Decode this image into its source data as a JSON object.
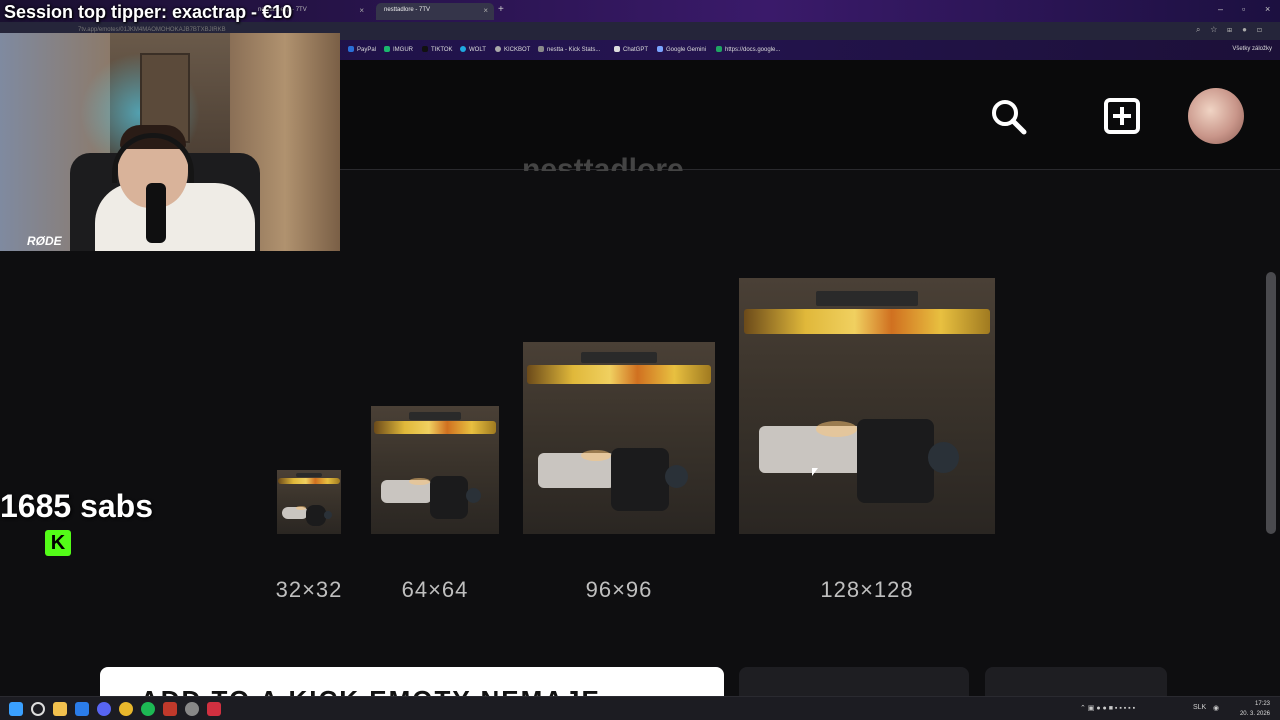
{
  "browser": {
    "tabs": [
      {
        "label": "nesttaseexp - 7TV",
        "active": false
      },
      {
        "label": "nesttadlore - 7TV",
        "active": true
      }
    ],
    "url": "7tv.app/emotes/01JKM4MAOMOHOKAJB7BTXBJIRKB",
    "bookmarks": [
      "PayPal",
      "IMGUR",
      "TIKTOK",
      "WOLT",
      "KICKBOT",
      "nestta - Kick Stats...",
      "ChatGPT",
      "Google Gemini",
      "https://docs.google..."
    ],
    "bookmarks_right": "Všetky záložky"
  },
  "overlay": {
    "title": "Session top tipper: exactrap - €10",
    "subs_count": "1685 sabs",
    "kick_logo": "K",
    "cam_brand": "RØDE"
  },
  "site": {
    "cut_title": "nesttadlore",
    "header_icons": [
      "search-icon",
      "add-icon",
      "avatar"
    ]
  },
  "emote_sizes": [
    {
      "label": "32×32"
    },
    {
      "label": "64×64"
    },
    {
      "label": "96×96"
    },
    {
      "label": "128×128"
    }
  ],
  "bottom": {
    "main_button": "ADD TO A KICK EMOTY NEMAJE"
  },
  "taskbar": {
    "lang": "SLK",
    "time": "17:23",
    "date": "20. 3. 2026"
  },
  "colors": {
    "kick_green": "#53fc18",
    "page_bg": "#0e0e10"
  }
}
